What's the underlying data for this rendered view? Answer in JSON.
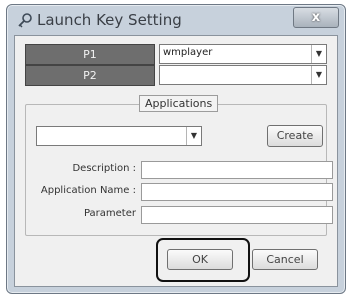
{
  "window": {
    "title": "Launch Key Setting",
    "close_label": "x"
  },
  "keys": {
    "p1_label": "P1",
    "p1_value": "wmplayer",
    "p2_label": "P2",
    "p2_value": ""
  },
  "applications": {
    "group_label": "Applications",
    "selected_app": "",
    "create_label": "Create",
    "fields": {
      "description_label": "Description :",
      "description_value": "",
      "app_name_label": "Application Name :",
      "app_name_value": "",
      "parameter_label": "Parameter",
      "parameter_value": ""
    }
  },
  "buttons": {
    "ok_label": "OK",
    "cancel_label": "Cancel"
  },
  "icons": {
    "title": "key-icon",
    "dropdown": "chevron-down-icon"
  }
}
